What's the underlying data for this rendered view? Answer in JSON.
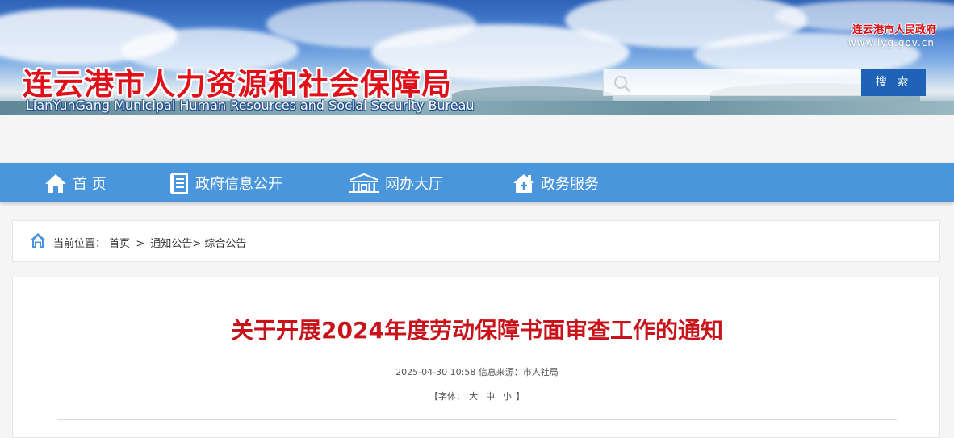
{
  "header": {
    "site_title_cn": "连云港市人力资源和社会保障局",
    "site_title_en": "LianYunGang Municipal Human Resources and Social Security Bureau",
    "gov_name": "连云港市人民政府",
    "gov_url": "www.lyg.gov.cn",
    "search": {
      "placeholder": "",
      "button_label": "搜 索"
    }
  },
  "nav": {
    "items": [
      {
        "label": "首 页",
        "icon": "home-icon"
      },
      {
        "label": "政府信息公开",
        "icon": "document-icon"
      },
      {
        "label": "网办大厅",
        "icon": "building-icon"
      },
      {
        "label": "政务服务",
        "icon": "service-icon"
      }
    ]
  },
  "breadcrumb": {
    "prefix": "当前位置：",
    "items": [
      "首页",
      "通知公告",
      "综合公告"
    ],
    "separator": ">"
  },
  "article": {
    "title": "关于开展2024年度劳动保障书面审查工作的通知",
    "date": "2025-04-30 10:58",
    "source_label": "信息来源：",
    "source": "市人社局",
    "font_size_prefix": "【字体：",
    "font_size_options": [
      "大",
      "中",
      "小"
    ],
    "font_size_suffix": "】"
  },
  "colors": {
    "title_red": "#c8131b",
    "nav_blue": "#4a96dc",
    "search_button": "#1e63b8"
  }
}
